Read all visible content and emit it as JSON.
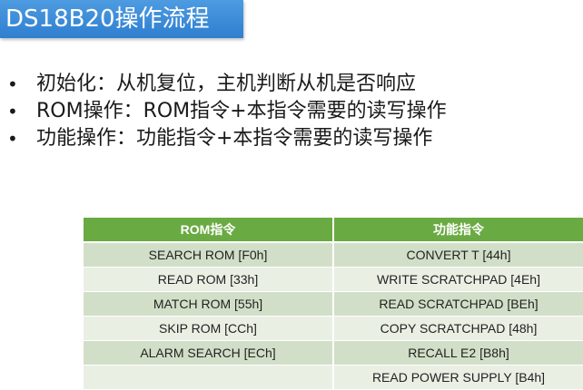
{
  "title": "DS18B20操作流程",
  "bullets": [
    "初始化：从机复位，主机判断从机是否响应",
    "ROM操作：ROM指令+本指令需要的读写操作",
    "功能操作：功能指令+本指令需要的读写操作"
  ],
  "bullet_marker": "•",
  "table": {
    "headers": [
      "ROM指令",
      "功能指令"
    ],
    "rows": [
      [
        "SEARCH ROM [F0h]",
        "CONVERT T [44h]"
      ],
      [
        "READ ROM [33h]",
        "WRITE SCRATCHPAD [4Eh]"
      ],
      [
        "MATCH ROM [55h]",
        "READ SCRATCHPAD [BEh]"
      ],
      [
        "SKIP ROM [CCh]",
        "COPY SCRATCHPAD [48h]"
      ],
      [
        "ALARM SEARCH [ECh]",
        "RECALL E2 [B8h]"
      ],
      [
        "",
        "READ POWER SUPPLY [B4h]"
      ]
    ]
  },
  "colors": {
    "title_bar": "#2f7fd1",
    "table_header": "#6aaa42",
    "row_dark": "#d2dfc8",
    "row_light": "#e9efe3"
  }
}
